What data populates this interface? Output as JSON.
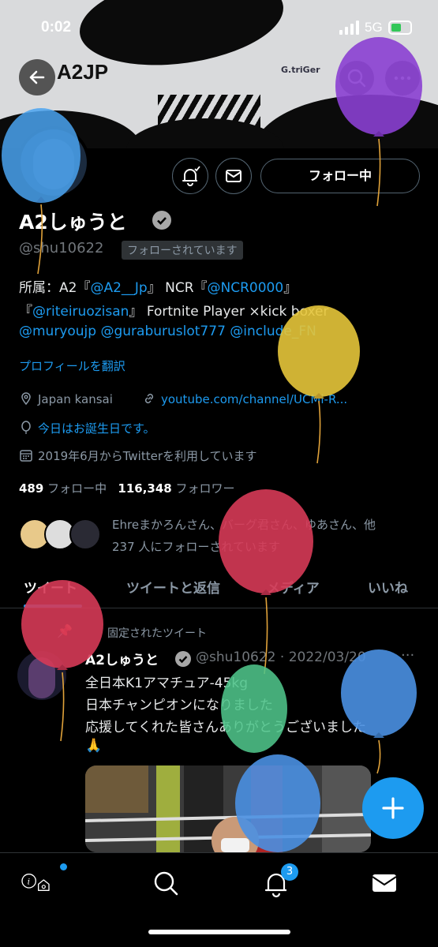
{
  "status_bar": {
    "time": "0:02",
    "network": "5G"
  },
  "header": {
    "logo_text": "A2JP",
    "sponsor": "G.triGer"
  },
  "profile": {
    "follow_button": "フォロー中",
    "name": "A2しゅうと",
    "handle": "@shu10622",
    "follows_you": "フォローされています",
    "bio": {
      "line1_a": "所属：A2『",
      "line1_link1": "@A2__Jp",
      "line1_b": "』 NCR『",
      "line1_link2": "@NCR0000",
      "line1_c": "』",
      "line2_a": "『",
      "line2_link": "@riteiruozisan",
      "line2_b": "』 Fortnite Player ×kick boxer",
      "line3_link1": "@muryoujp",
      "line3_link2": "@guraburuslot777",
      "line3_link3": "@include_FN"
    },
    "translate": "プロフィールを翻訳",
    "location": "Japan kansai",
    "website": "youtube.com/channel/UCMi-R...",
    "birthday": "今日はお誕生日です。",
    "joined": "2019年6月からTwitterを利用しています",
    "following_count": "489",
    "following_label": "フォロー中",
    "followers_count": "116,348",
    "followers_label": "フォロワー",
    "mutuals_line1": "Ehreまかろんさん、バーグ君さん、ゆあさん、他",
    "mutuals_line2": "237 人にフォローされています"
  },
  "tabs": [
    "ツイート",
    "ツイートと返信",
    "メディア",
    "いいね"
  ],
  "tweet": {
    "pinned_label": "固定されたツイート",
    "name": "A2しゅうと",
    "handle_date": "@shu10622 · 2022/03/20",
    "more": "···",
    "lines": [
      "全日本K1アマチュア-45kg",
      "日本チャンピオンになりました",
      "応援してくれた皆さんありがとうございました",
      "🙏"
    ]
  },
  "bottom_nav": {
    "notification_badge": "3"
  },
  "icons": [
    "back-arrow-icon",
    "search-icon",
    "more-icon",
    "bell-icon",
    "mail-icon",
    "verified-icon",
    "location-icon",
    "link-icon",
    "balloon-icon",
    "calendar-icon",
    "pin-icon",
    "plus-icon",
    "home-icon",
    "notifications-icon",
    "messages-icon"
  ],
  "colors": {
    "accent": "#1d9bf0",
    "background": "#000000",
    "text": "#e7e9ea",
    "secondary": "#8b98a5"
  }
}
